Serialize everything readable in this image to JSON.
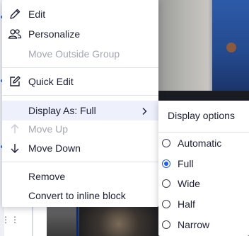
{
  "menu": {
    "items": [
      {
        "label": "Edit",
        "icon": "pencil-icon",
        "disabled": false
      },
      {
        "label": "Personalize",
        "icon": "users-icon",
        "disabled": false
      },
      {
        "label": "Move Outside Group",
        "icon": "",
        "disabled": true
      },
      {
        "label": "Quick Edit",
        "icon": "edit-square-icon",
        "disabled": false
      },
      {
        "label": "Display As: Full",
        "icon": "",
        "disabled": false,
        "has_submenu": true,
        "highlighted": true
      },
      {
        "label": "Move Up",
        "icon": "arrow-up-icon",
        "disabled": true
      },
      {
        "label": "Move Down",
        "icon": "arrow-down-icon",
        "disabled": false
      },
      {
        "label": "Remove",
        "icon": "",
        "disabled": false
      },
      {
        "label": "Convert to inline block",
        "icon": "",
        "disabled": false
      }
    ]
  },
  "submenu": {
    "title": "Display options",
    "options": [
      {
        "label": "Automatic",
        "checked": false
      },
      {
        "label": "Full",
        "checked": true
      },
      {
        "label": "Wide",
        "checked": false
      },
      {
        "label": "Half",
        "checked": false
      },
      {
        "label": "Narrow",
        "checked": false
      }
    ]
  },
  "colors": {
    "text": "#1c1f36",
    "disabled_text": "#a3a6b4",
    "highlight": "#eef0fc",
    "accent": "#1f5ce8"
  }
}
